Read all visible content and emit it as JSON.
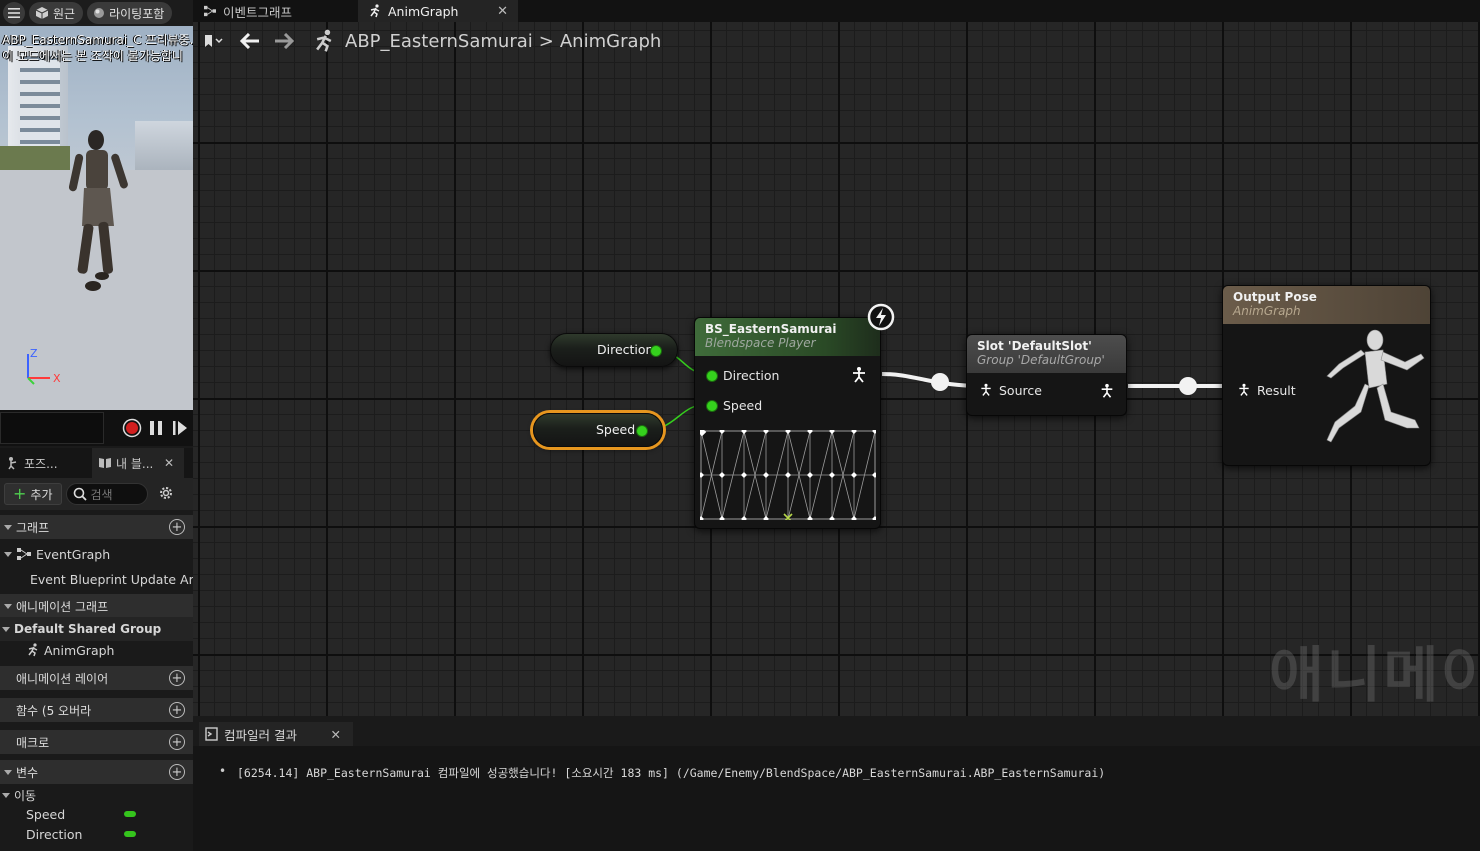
{
  "viewport": {
    "toolbar": {
      "perspective_label": "원근",
      "lighting_label": "라이팅포함"
    },
    "message_line1": "ABP_EasternSamurai_C 프리뷰중.",
    "message_line2": "이 모드에서는 본 조작이 불가능합니",
    "axis_z": "Z",
    "axis_x": "X"
  },
  "left_tabs": {
    "pose_tab": "포즈...",
    "my_blueprint_tab": "내 블..."
  },
  "my_blueprint": {
    "add_label": "추가",
    "search_placeholder": "검색",
    "sections": {
      "graphs": "그래프",
      "event_graph": "EventGraph",
      "event_update": "Event Blueprint Update Ar",
      "anim_graphs": "애니메이션 그래프",
      "default_group": "Default Shared Group",
      "anim_graph": "AnimGraph",
      "anim_layers": "애니메이션 레이어",
      "functions": "함수 (5 오버라",
      "macros": "매크로",
      "variables": "변수",
      "category": "이동",
      "var_speed": "Speed",
      "var_direction": "Direction"
    }
  },
  "doc_tabs": {
    "event_graph": "이벤트그래프",
    "anim_graph": "AnimGraph"
  },
  "breadcrumb": {
    "asset": "ABP_EasternSamurai",
    "graph": "AnimGraph",
    "separator": ">"
  },
  "nodes": {
    "direction_var": "Direction",
    "speed_var": "Speed",
    "blendspace": {
      "title": "BS_EasternSamurai",
      "subtitle": "Blendspace Player",
      "pin_direction": "Direction",
      "pin_speed": "Speed"
    },
    "slot": {
      "title": "Slot 'DefaultSlot'",
      "subtitle": "Group 'DefaultGroup'",
      "pin_source": "Source"
    },
    "output": {
      "title": "Output Pose",
      "subtitle": "AnimGraph",
      "pin_result": "Result"
    }
  },
  "watermark": "애니메이",
  "compiler": {
    "tab_label": "컴파일러 결과",
    "message": "[6254.14] ABP_EasternSamurai 컴파일에 성공했습니다! [소요시간 183 ms] (/Game/Enemy/BlendSpace/ABP_EasternSamurai.ABP_EasternSamurai)"
  },
  "colors": {
    "pin_float": "#35d11d",
    "blendspace_header": "#3f6b3a",
    "slot_header": "#4a4a4a",
    "output_header": "#6b5c4a",
    "selection": "#e6961f"
  }
}
